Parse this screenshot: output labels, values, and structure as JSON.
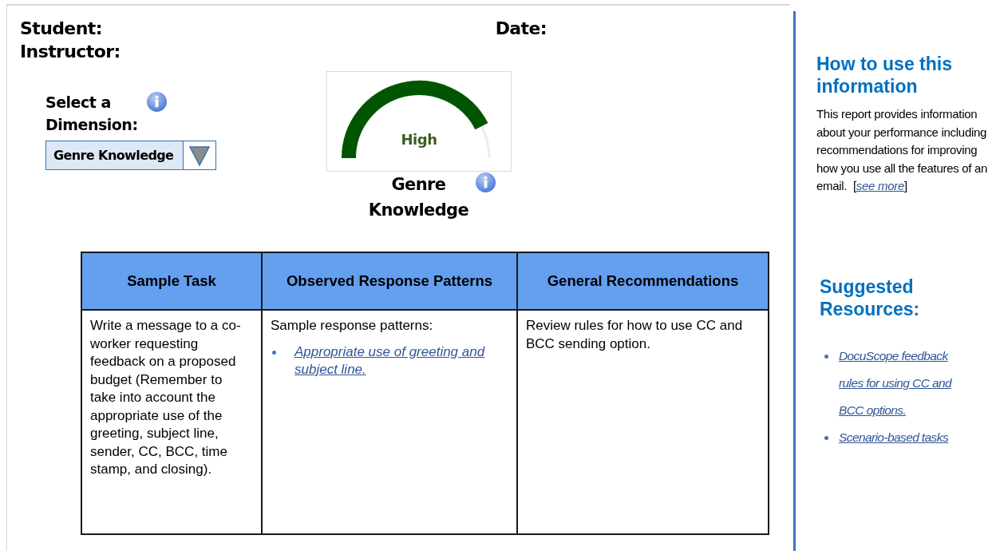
{
  "header": {
    "student_label": "Student:",
    "date_label": "Date:",
    "instructor_label": "Instructor:"
  },
  "dimension": {
    "label": "Select a Dimension:",
    "value": "Genre Knowledge"
  },
  "gauge": {
    "reading": "High",
    "title": "Genre Knowledge"
  },
  "table": {
    "columns": [
      "Sample Task",
      "Observed Response Patterns",
      "General Recommendations"
    ],
    "rows": [
      {
        "task": "Write a message to a co-worker requesting feedback on a proposed budget (Remember to take into account the appropriate use of the greeting, subject line, sender, CC, BCC, time stamp, and closing).",
        "patterns_intro": "Sample response patterns:",
        "pattern_links": [
          "Appropriate use of greeting and subject line."
        ],
        "recommendation": "Review rules for how to use CC and BCC sending option."
      }
    ]
  },
  "sidebar": {
    "how_title": "How to use this information",
    "how_text": "This report provides information about your performance including  recommendations for improving how you use all the features of an email.",
    "see_more_open": "[",
    "see_more": "see more",
    "see_more_close": "]",
    "resources_title": "Suggested Resources:",
    "resources": [
      "DocuScope feedback rules for using CC and BCC options.",
      "Scenario-based tasks"
    ]
  }
}
